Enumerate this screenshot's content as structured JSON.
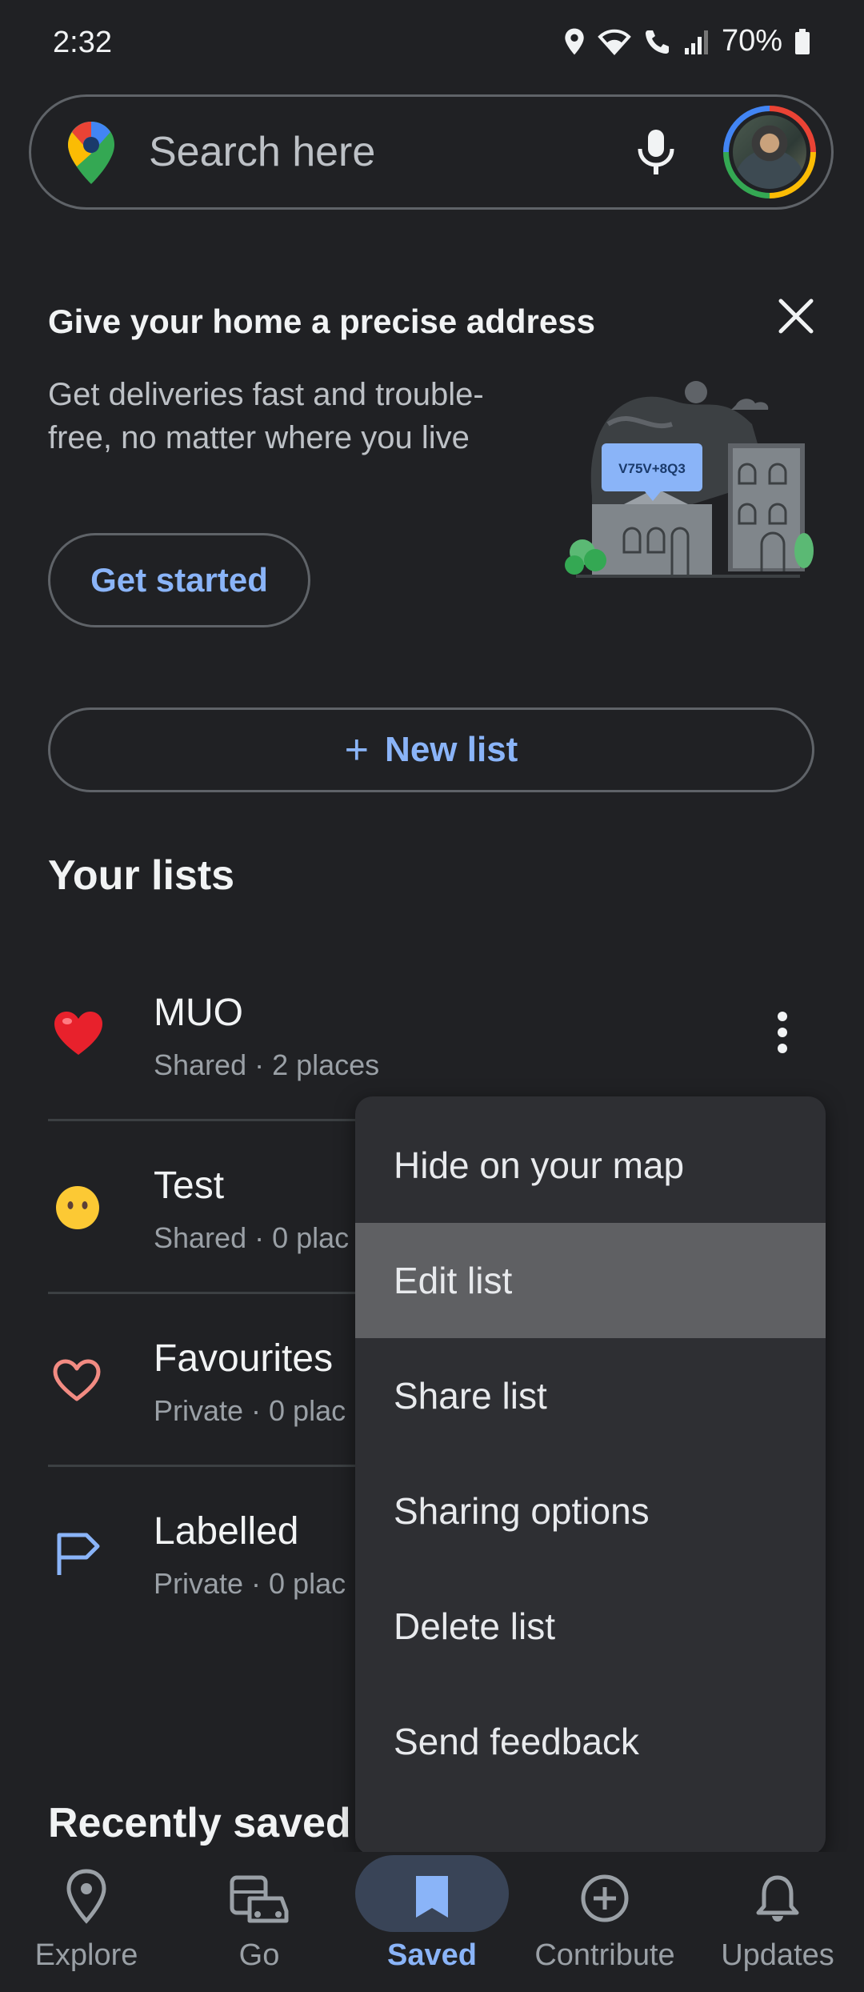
{
  "status_bar": {
    "time": "2:32",
    "battery": "70%"
  },
  "search": {
    "placeholder": "Search here"
  },
  "promo": {
    "title": "Give your home a precise address",
    "body": "Get deliveries fast and trouble-free, no matter where you live",
    "cta": "Get started",
    "plus_code": "V75V+8Q3"
  },
  "new_list": {
    "label": "New list"
  },
  "your_lists": {
    "heading": "Your lists",
    "items": [
      {
        "title": "MUO",
        "subtitle": "Shared · 2 places",
        "icon": "red-heart-emoji"
      },
      {
        "title": "Test",
        "subtitle": "Shared · 0 plac",
        "icon": "neutral-face-emoji"
      },
      {
        "title": "Favourites",
        "subtitle": "Private · 0 plac",
        "icon": "heart-outline-icon"
      },
      {
        "title": "Labelled",
        "subtitle": "Private · 0 plac",
        "icon": "flag-icon"
      }
    ]
  },
  "menu": {
    "items": [
      "Hide on your map",
      "Edit list",
      "Share list",
      "Sharing options",
      "Delete list",
      "Send feedback"
    ],
    "highlighted": "Edit list"
  },
  "recently_saved": {
    "heading": "Recently saved"
  },
  "bottom_nav": {
    "items": [
      {
        "label": "Explore",
        "icon": "location-pin-icon"
      },
      {
        "label": "Go",
        "icon": "commute-icon"
      },
      {
        "label": "Saved",
        "icon": "bookmark-icon",
        "active": true
      },
      {
        "label": "Contribute",
        "icon": "add-circle-icon"
      },
      {
        "label": "Updates",
        "icon": "bell-icon"
      }
    ]
  },
  "colors": {
    "accent": "#8ab4f8",
    "background": "#202124",
    "menu": "#2e2f33",
    "highlight": "#5f6063"
  }
}
